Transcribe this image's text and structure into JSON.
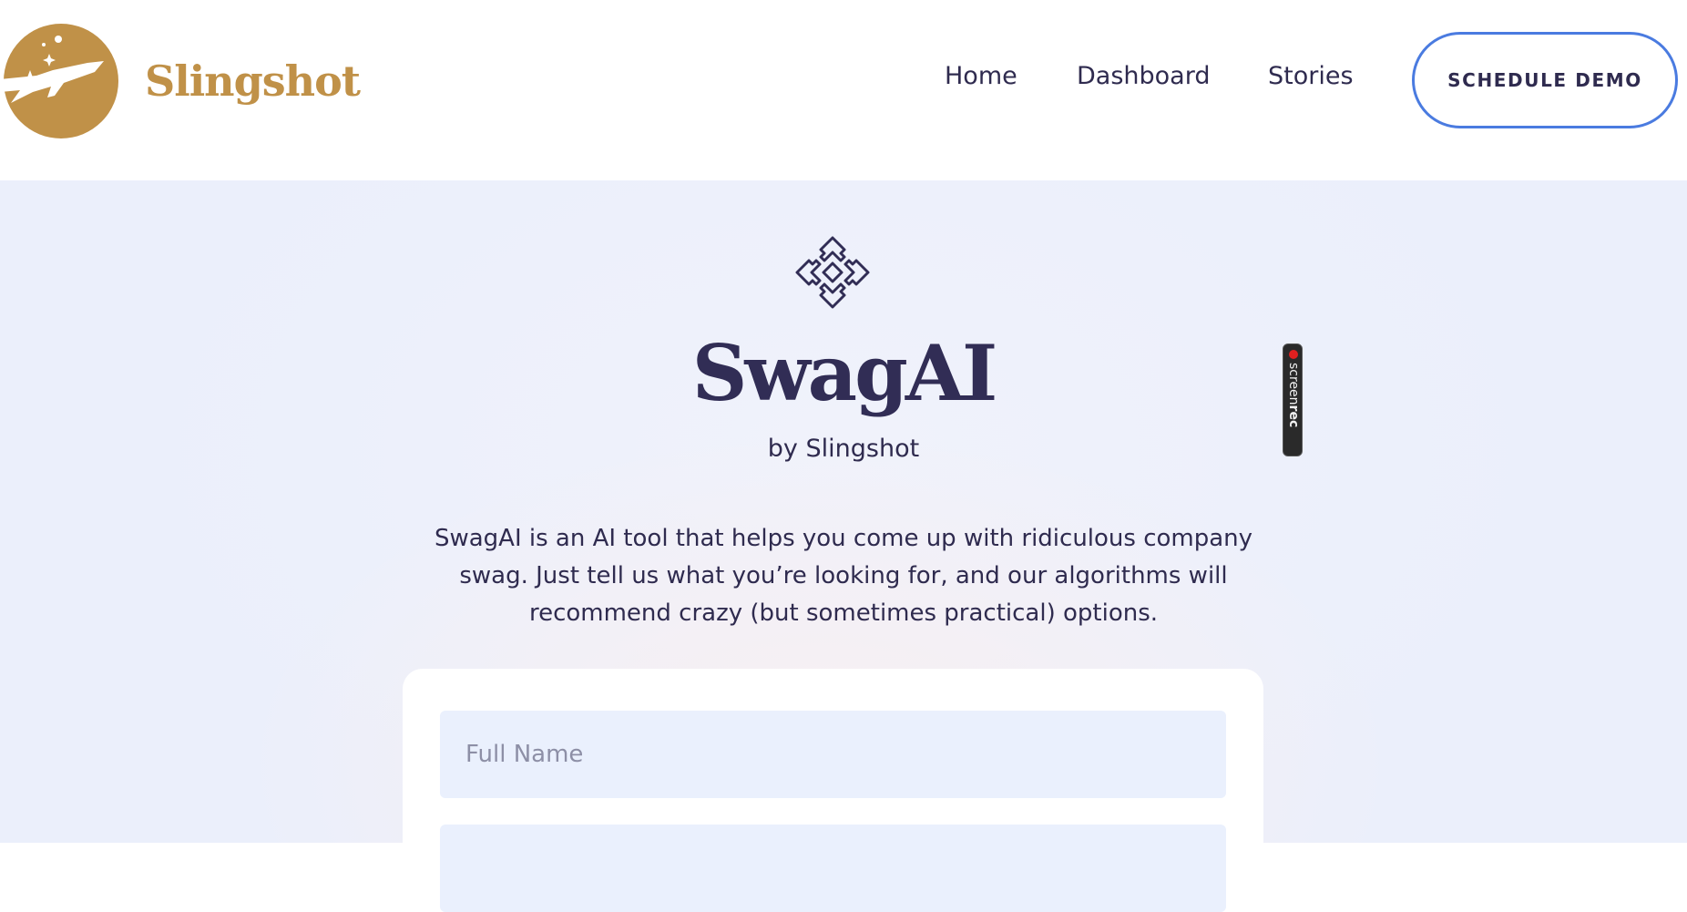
{
  "header": {
    "brand_name": "Slingshot",
    "nav": [
      {
        "label": "Home"
      },
      {
        "label": "Dashboard"
      },
      {
        "label": "Stories"
      }
    ],
    "cta_label": "SCHEDULE DEMO"
  },
  "hero": {
    "icon": "puzzle-pieces-icon",
    "title": "SwagAI",
    "subtitle": "by Slingshot",
    "description": "SwagAI is an AI tool that helps you come up with ridiculous company swag. Just tell us what you’re looking for, and our algorithms will recommend crazy (but sometimes practical) options."
  },
  "form": {
    "full_name_placeholder": "Full Name",
    "full_name_value": "",
    "second_field_placeholder": ""
  },
  "overlay": {
    "recorder_label_light": "screen",
    "recorder_label_bold": "rec"
  },
  "colors": {
    "brand_gold": "#c09148",
    "text_dark": "#2f2b4f",
    "cta_border": "#4a7be0",
    "input_bg": "#eaf0fd",
    "hero_bg": "#edf0fb"
  }
}
